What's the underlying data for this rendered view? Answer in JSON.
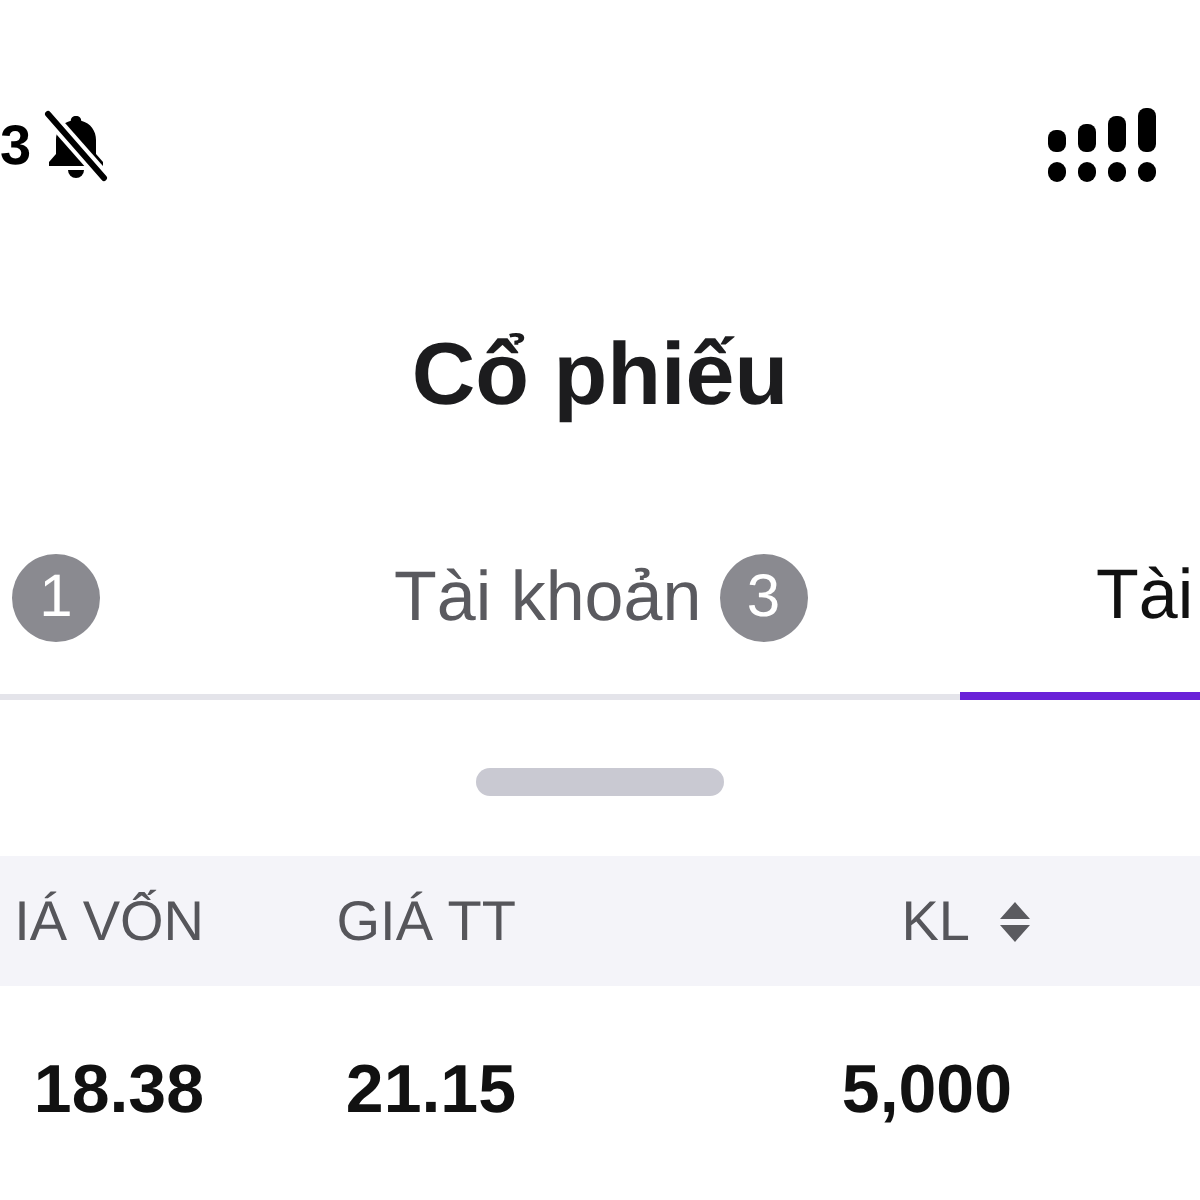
{
  "status_bar": {
    "time": "3"
  },
  "title": "Cổ phiếu",
  "tabs": [
    {
      "badge": "1",
      "selected": false
    },
    {
      "label": "Tài khoản",
      "badge": "3",
      "selected": false
    },
    {
      "label": "Tài",
      "selected": true
    }
  ],
  "table": {
    "columns": [
      {
        "label": "IÁ VỐN",
        "sortable": false
      },
      {
        "label": "GIÁ TT",
        "sortable": false
      },
      {
        "label": "KL",
        "sortable": true
      }
    ],
    "rows": [
      [
        "18.38",
        "21.15",
        "5,000"
      ]
    ]
  }
}
